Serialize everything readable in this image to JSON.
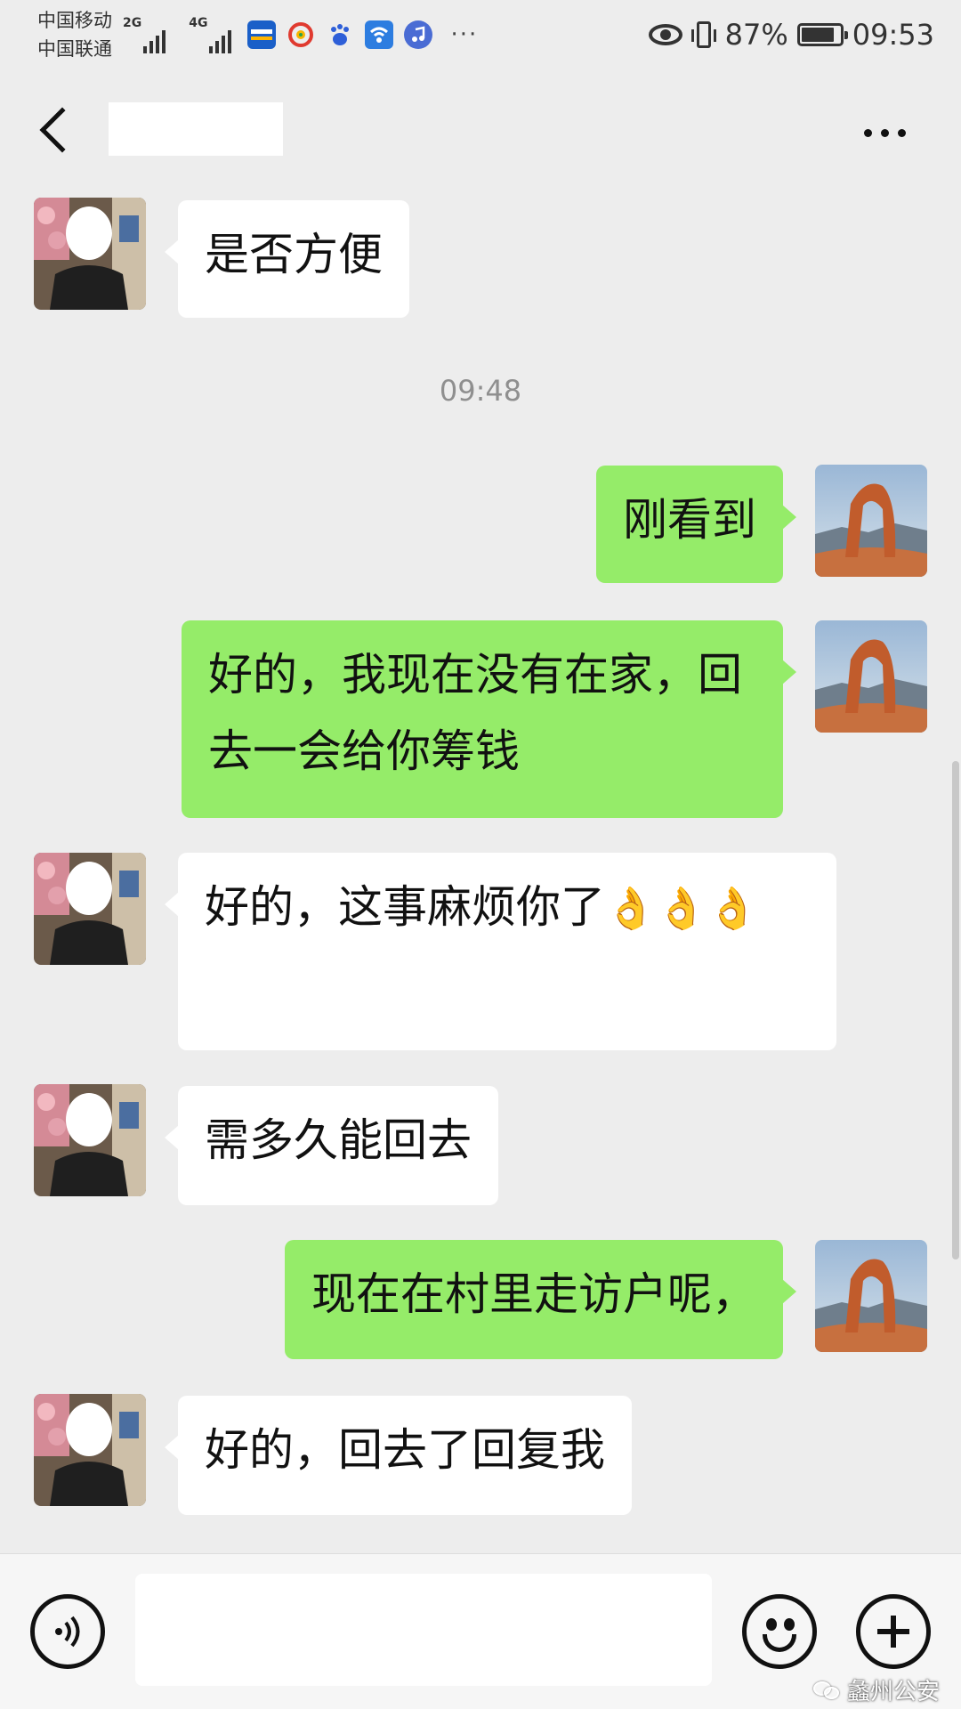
{
  "status_bar": {
    "carrier_1": "中国移动",
    "carrier_2": "中国联通",
    "net_1": "2G",
    "net_2": "4G",
    "battery": "87%",
    "battery_level": 0.87,
    "time": "09:53",
    "overflow": "···",
    "app_icons": [
      {
        "name": "autohome-icon",
        "color": "#1a5fc8"
      },
      {
        "name": "weibo-icon",
        "color": "#ffffff"
      },
      {
        "name": "baidu-icon",
        "color": "#ffffff"
      },
      {
        "name": "wifi-hotspot-icon",
        "color": "#2d7de0"
      },
      {
        "name": "music-icon",
        "color": "#4a6cd4"
      }
    ]
  },
  "header": {
    "title": "",
    "back_icon": "chevron-left-icon",
    "menu_icon": "more-icon"
  },
  "messages": [
    {
      "sender": "contact",
      "text": "是否方便"
    },
    {
      "type": "time",
      "text": "09:48"
    },
    {
      "sender": "self",
      "text": "刚看到"
    },
    {
      "sender": "self",
      "text": "好的，我现在没有在家，回去一会给你筹钱"
    },
    {
      "sender": "contact",
      "text": "好的，这事麻烦你了",
      "emoji": "👌"
    },
    {
      "sender": "contact",
      "text": "需多久能回去"
    },
    {
      "sender": "self",
      "text": "现在在村里走访户呢，"
    },
    {
      "sender": "contact",
      "text": "好的，回去了回复我"
    }
  ],
  "input_bar": {
    "placeholder": "",
    "voice_icon": "voice-icon",
    "emoji_icon": "emoji-icon",
    "plus_icon": "plus-icon"
  },
  "watermark": "蠡州公安",
  "colors": {
    "background": "#ededed",
    "self_bubble": "#95ec69",
    "contact_bubble": "#ffffff",
    "timestamp": "#8f8f8f"
  }
}
